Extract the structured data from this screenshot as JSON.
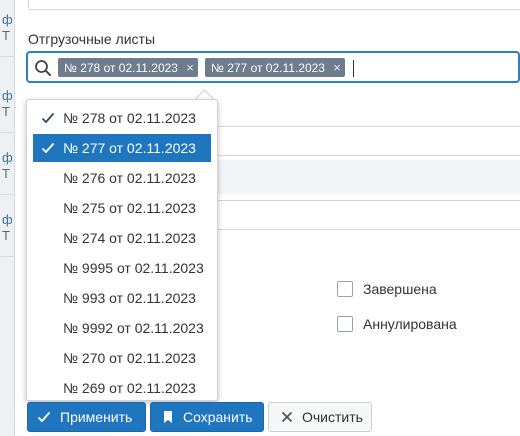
{
  "field": {
    "label": "Отгрузочные листы",
    "chips": [
      {
        "label": "№ 278 от 02.11.2023"
      },
      {
        "label": "№ 277 от 02.11.2023"
      }
    ],
    "chip_remove_glyph": "×"
  },
  "background": {
    "left_rows": [
      {
        "l1": "ф",
        "l2": "Т"
      },
      {
        "l1": "ф",
        "l2": "Т"
      },
      {
        "l1": "ф",
        "l2": "Т"
      },
      {
        "l1": "ф",
        "l2": "Т"
      }
    ]
  },
  "dropdown": {
    "options": [
      {
        "label": "№ 278 от 02.11.2023",
        "checked": true,
        "active": false
      },
      {
        "label": "№ 277 от 02.11.2023",
        "checked": true,
        "active": true
      },
      {
        "label": "№ 276 от 02.11.2023",
        "checked": false,
        "active": false
      },
      {
        "label": "№ 275 от 02.11.2023",
        "checked": false,
        "active": false
      },
      {
        "label": "№ 274 от 02.11.2023",
        "checked": false,
        "active": false
      },
      {
        "label": "№ 9995 от 02.11.2023",
        "checked": false,
        "active": false
      },
      {
        "label": "№ 993 от 02.11.2023",
        "checked": false,
        "active": false
      },
      {
        "label": "№ 9992 от 02.11.2023",
        "checked": false,
        "active": false
      },
      {
        "label": "№ 270 от 02.11.2023",
        "checked": false,
        "active": false
      },
      {
        "label": "№ 269 от 02.11.2023",
        "checked": false,
        "active": false
      }
    ]
  },
  "checkboxes": [
    {
      "label": "Завершена",
      "checked": false
    },
    {
      "label": "Аннулирована",
      "checked": false
    }
  ],
  "buttons": {
    "apply": "Применить",
    "save": "Сохранить",
    "clear": "Очистить"
  },
  "colors": {
    "accent": "#1f76bf",
    "chip": "#6d7d8d"
  }
}
